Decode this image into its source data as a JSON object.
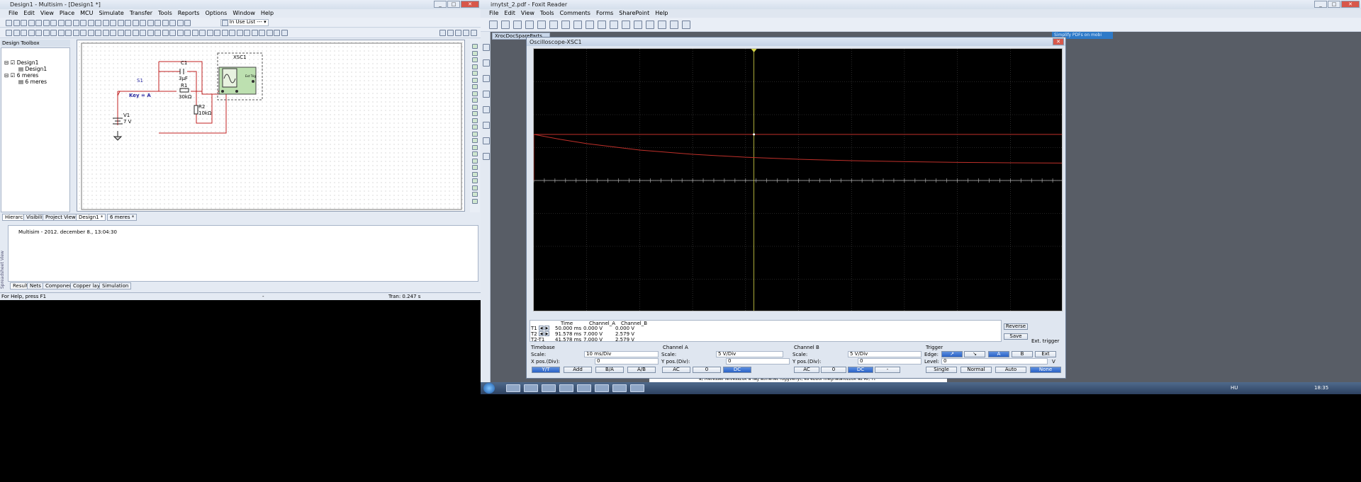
{
  "multisim": {
    "title": "Design1 - Multisim - [Design1 *]",
    "menu": [
      "File",
      "Edit",
      "View",
      "Place",
      "MCU",
      "Simulate",
      "Transfer",
      "Tools",
      "Reports",
      "Options",
      "Window",
      "Help"
    ],
    "in_use_list": "--- In Use List ---",
    "toolbox_title": "Design Toolbox",
    "tree": [
      "Design1",
      "Design1",
      "6 meres",
      "6 meres"
    ],
    "toolbox_tabs": [
      "Hierarchy",
      "Visibility",
      "Project View"
    ],
    "doc_tabs": [
      "Design1 *",
      "6 meres *"
    ],
    "schematic": {
      "c1": "C1",
      "c1_val": "3µF",
      "r1": "R1",
      "r1_val": "30kΩ",
      "r2": "R2",
      "r2_val": "10kΩ",
      "v1": "V1",
      "v1_val": "7 V",
      "s1": "S1",
      "key": "Key = A",
      "xsc": "XSC1",
      "ext_trig": "Ext Trig"
    },
    "log_line": "Multisim  -  2012. december 8., 13:04:30",
    "spreadsheet_label": "Spreadsheet View",
    "bottom_tabs": [
      "Results",
      "Nets",
      "Components",
      "Copper layers",
      "Simulation"
    ],
    "status_left": "For Help, press F1",
    "status_dash": "-",
    "status_tran": "Tran: 0.247 s"
  },
  "foxit": {
    "title": "irnytst_2.pdf - Foxit Reader",
    "menu": [
      "File",
      "Edit",
      "View",
      "Tools",
      "Comments",
      "Forms",
      "SharePoint",
      "Help"
    ],
    "side_tab": "XrocDocSpareParts...",
    "banner": "Simplify PDFs on mobi",
    "doc_text": "a)  Méréssel felvesszük a fág átmenét függvényt, és ebből meghatározzuk az A₀, T₁"
  },
  "scope": {
    "title": "Oscilloscope-XSC1",
    "trace_color": "#c0302a",
    "cursor_color": "#d8d84a",
    "chart_data": {
      "type": "line",
      "xlim": [
        0,
        100
      ],
      "ylim": [
        -20,
        20
      ],
      "x_unit": "ms",
      "y_unit": "V",
      "series": [
        {
          "name": "Channel_A",
          "points": [
            [
              0,
              7
            ],
            [
              100,
              7
            ]
          ]
        },
        {
          "name": "Channel_B",
          "points": [
            [
              0,
              7
            ],
            [
              5,
              6.25
            ],
            [
              10,
              5.6
            ],
            [
              20,
              4.63
            ],
            [
              30,
              3.98
            ],
            [
              40,
              3.53
            ],
            [
              50,
              3.22
            ],
            [
              60,
              3.01
            ],
            [
              70,
              2.86
            ],
            [
              80,
              2.76
            ],
            [
              90,
              2.69
            ],
            [
              100,
              2.65
            ]
          ]
        }
      ]
    },
    "readout": {
      "headers": [
        "Time",
        "Channel_A",
        "Channel_B"
      ],
      "rows": [
        {
          "label": "T1",
          "time": "50.000 ms",
          "a": "0.000 V",
          "b": "0.000 V"
        },
        {
          "label": "T2",
          "time": "91.578 ms",
          "a": "7.000 V",
          "b": "2.579 V"
        },
        {
          "label": "T2-T1",
          "time": "41.578 ms",
          "a": "7.000 V",
          "b": "2.579 V"
        }
      ]
    },
    "reverse": "Reverse",
    "save": "Save",
    "ext_trigger": "Ext. trigger",
    "timebase": {
      "title": "Timebase",
      "scale_label": "Scale:",
      "scale": "10 ms/Div",
      "xpos_label": "X pos.(Div):",
      "xpos": "0",
      "buttons": [
        "Y/T",
        "Add",
        "B/A",
        "A/B"
      ]
    },
    "channel_a": {
      "title": "Channel A",
      "scale_label": "Scale:",
      "scale": "5 V/Div",
      "ypos_label": "Y pos.(Div):",
      "ypos": "0",
      "buttons": [
        "AC",
        "0",
        "DC"
      ]
    },
    "channel_b": {
      "title": "Channel B",
      "scale_label": "Scale:",
      "scale": "5 V/Div",
      "ypos_label": "Y pos.(Div):",
      "ypos": "0",
      "buttons": [
        "AC",
        "0",
        "DC",
        "-"
      ]
    },
    "trigger": {
      "title": "Trigger",
      "edge_label": "Edge:",
      "level_label": "Level:",
      "level": "0",
      "level_unit": "V",
      "sources": [
        "A",
        "B",
        "Ext"
      ],
      "modes": [
        "Single",
        "Normal",
        "Auto",
        "None"
      ]
    }
  },
  "taskbar": {
    "lang": "HU",
    "clock": "18:35"
  }
}
